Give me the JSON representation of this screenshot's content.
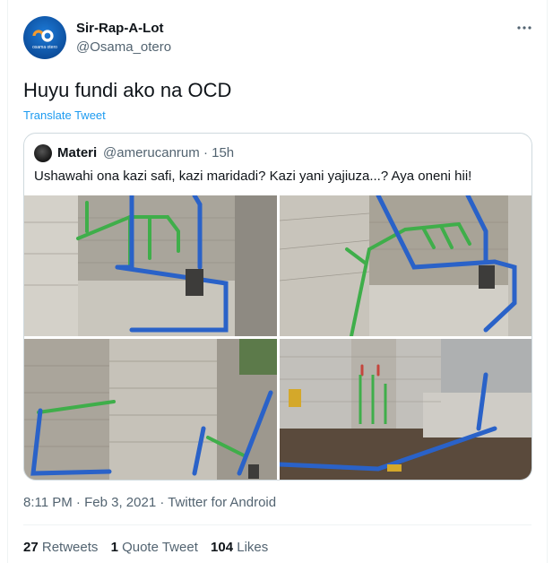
{
  "author": {
    "name": "Sir-Rap-A-Lot",
    "handle": "@Osama_otero",
    "avatar_text": "osama otero"
  },
  "tweet": {
    "text": "Huyu fundi ako na OCD",
    "translate_label": "Translate Tweet",
    "more_icon": "more-dots-icon"
  },
  "quoted": {
    "name": "Materi",
    "handle": "@amerucanrum",
    "time": "· 15h",
    "text": "Ushawahi ona kazi safi, kazi maridadi? Kazi yani yajiuza...? Aya oneni hii!",
    "photos": [
      {
        "description_icon": "plumbing-photo-1"
      },
      {
        "description_icon": "plumbing-photo-2"
      },
      {
        "description_icon": "plumbing-photo-3"
      },
      {
        "description_icon": "plumbing-photo-4"
      }
    ]
  },
  "meta": {
    "time": "8:11 PM",
    "sep1": " · ",
    "date": "Feb 3, 2021",
    "sep2": " · ",
    "source": "Twitter for Android"
  },
  "stats": {
    "retweets_count": "27",
    "retweets_label": "Retweets",
    "quotes_count": "1",
    "quotes_label": "Quote Tweet",
    "likes_count": "104",
    "likes_label": "Likes"
  },
  "colors": {
    "link": "#1d9bf0",
    "secondary": "#536471",
    "border": "#cfd9de",
    "pipe_green": "#3fae4a",
    "pipe_blue": "#2a62c8"
  }
}
